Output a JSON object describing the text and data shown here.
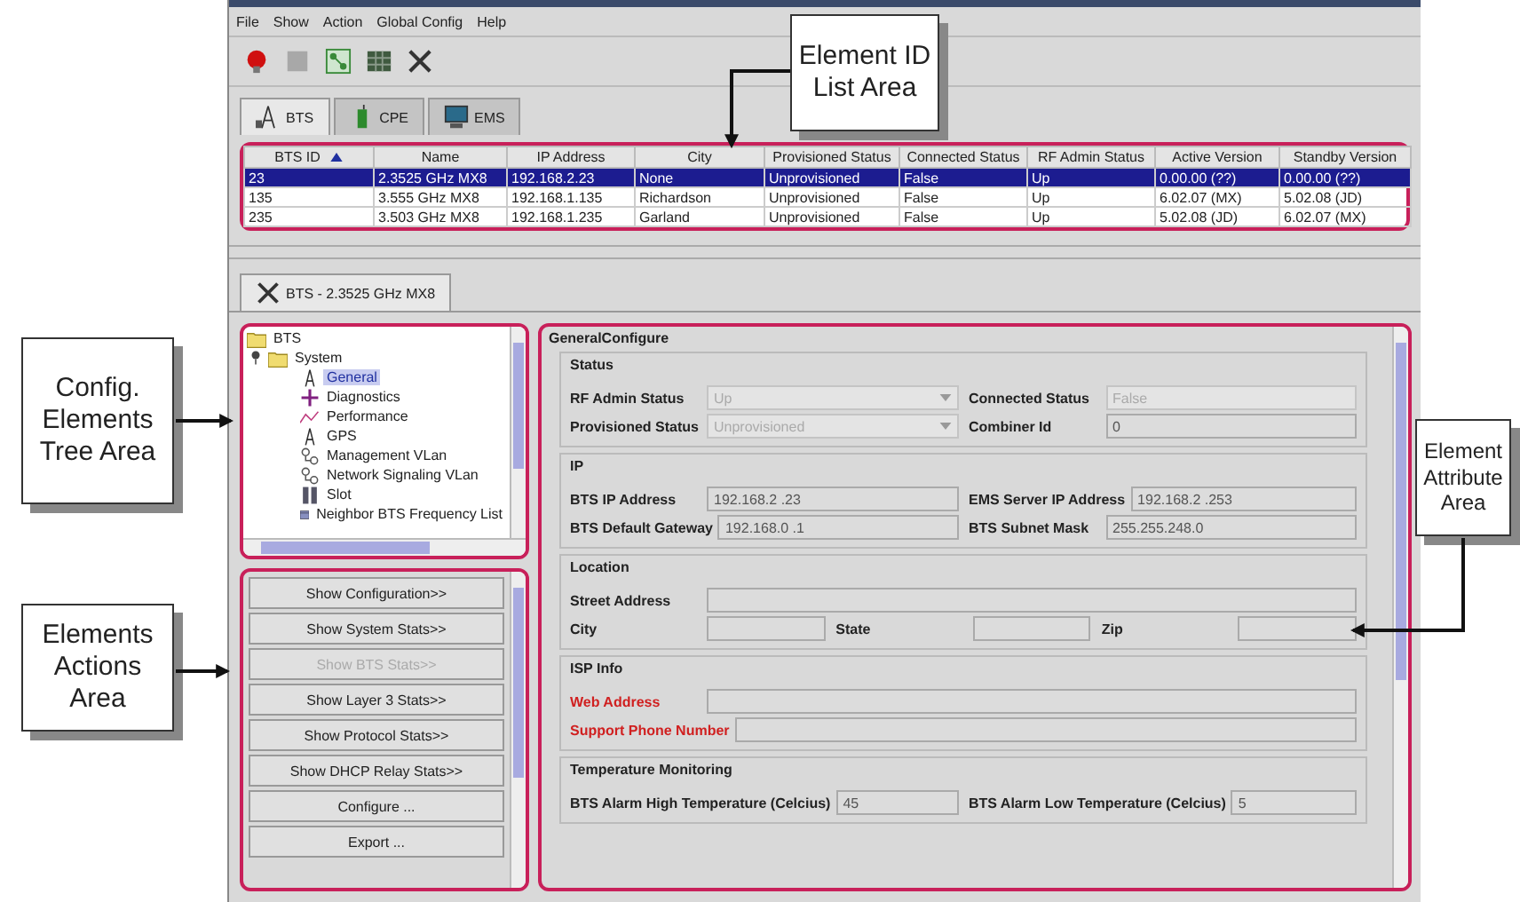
{
  "menu": [
    "File",
    "Show",
    "Action",
    "Global Config",
    "Help"
  ],
  "tabs": [
    {
      "label": "BTS",
      "kind": "tower",
      "selected": true
    },
    {
      "label": "CPE",
      "kind": "phone",
      "selected": false
    },
    {
      "label": "EMS",
      "kind": "monitor",
      "selected": false
    }
  ],
  "table": {
    "columns": [
      {
        "label": "BTS ID",
        "sorted": true
      },
      {
        "label": "Name",
        "sorted": false
      },
      {
        "label": "IP Address",
        "sorted": false
      },
      {
        "label": "City",
        "sorted": false
      },
      {
        "label": "Provisioned Status",
        "sorted": false
      },
      {
        "label": "Connected Status",
        "sorted": false
      },
      {
        "label": "RF Admin Status",
        "sorted": false
      },
      {
        "label": "Active Version",
        "sorted": false
      },
      {
        "label": "Standby Version",
        "sorted": false
      }
    ],
    "rows": [
      {
        "selected": true,
        "cells": [
          "23",
          "2.3525 GHz MX8",
          "192.168.2.23",
          "None",
          "Unprovisioned",
          "False",
          "Up",
          "0.00.00 (??)",
          "0.00.00 (??)"
        ]
      },
      {
        "selected": false,
        "cells": [
          "135",
          "3.555 GHz MX8",
          "192.168.1.135",
          "Richardson",
          "Unprovisioned",
          "False",
          "Up",
          "6.02.07 (MX)",
          "5.02.08 (JD)"
        ]
      },
      {
        "selected": false,
        "cells": [
          "235",
          "3.503 GHz MX8",
          "192.168.1.235",
          "Garland",
          "Unprovisioned",
          "False",
          "Up",
          "5.02.08 (JD)",
          "6.02.07 (MX)"
        ]
      }
    ]
  },
  "element_tab": "BTS - 2.3525 GHz MX8",
  "tree": [
    {
      "label": "BTS",
      "kind": "folder",
      "selected": false,
      "children": [
        {
          "label": "System",
          "kind": "folder",
          "selected": false,
          "expanded": true,
          "children": [
            {
              "label": "General",
              "kind": "tower",
              "selected": true
            },
            {
              "label": "Diagnostics",
              "kind": "diag",
              "selected": false
            },
            {
              "label": "Performance",
              "kind": "chart",
              "selected": false
            },
            {
              "label": "GPS",
              "kind": "tower",
              "selected": false
            },
            {
              "label": "Management VLan",
              "kind": "network",
              "selected": false
            },
            {
              "label": "Network Signaling VLan",
              "kind": "network",
              "selected": false
            },
            {
              "label": "Slot",
              "kind": "slot",
              "selected": false
            },
            {
              "label": "Neighbor BTS Frequency List",
              "kind": "list",
              "selected": false
            }
          ]
        }
      ]
    }
  ],
  "actions": [
    {
      "label": "Show Configuration>>",
      "disabled": false
    },
    {
      "label": "Show System Stats>>",
      "disabled": false
    },
    {
      "label": "Show BTS Stats>>",
      "disabled": true
    },
    {
      "label": "Show Layer 3 Stats>>",
      "disabled": false
    },
    {
      "label": "Show Protocol Stats>>",
      "disabled": false
    },
    {
      "label": "Show DHCP Relay Stats>>",
      "disabled": false
    },
    {
      "label": "Configure ...",
      "disabled": false
    },
    {
      "label": "Export ...",
      "disabled": false
    }
  ],
  "attributes": {
    "title": "GeneralConfigure",
    "sections": [
      {
        "title": "Status",
        "rows": [
          [
            {
              "label": "RF Admin Status",
              "value": "Up",
              "kind": "dropdown",
              "disabled": true,
              "required": false
            },
            {
              "label": "Connected Status",
              "value": "False",
              "kind": "text",
              "disabled": true,
              "required": false
            }
          ],
          [
            {
              "label": "Provisioned Status",
              "value": "Unprovisioned",
              "kind": "dropdown",
              "disabled": true,
              "required": false
            },
            {
              "label": "Combiner Id",
              "value": "0",
              "kind": "text",
              "disabled": false,
              "required": false
            }
          ]
        ]
      },
      {
        "title": "IP",
        "rows": [
          [
            {
              "label": "BTS IP Address",
              "value": "192.168.2 .23",
              "kind": "text",
              "disabled": false,
              "required": false
            },
            {
              "label": "EMS Server IP Address",
              "value": "192.168.2 .253",
              "kind": "text",
              "disabled": false,
              "required": false
            }
          ],
          [
            {
              "label": "BTS Default Gateway",
              "value": "192.168.0 .1",
              "kind": "text",
              "disabled": false,
              "required": false
            },
            {
              "label": "BTS Subnet Mask",
              "value": "255.255.248.0",
              "kind": "text",
              "disabled": false,
              "required": false
            }
          ]
        ]
      },
      {
        "title": "Location",
        "rows": [
          [
            {
              "label": "Street Address",
              "kind": "text",
              "disabled": false,
              "required": false
            }
          ],
          [
            {
              "label": "City",
              "kind": "text",
              "disabled": false,
              "required": false
            },
            {
              "label": "State",
              "kind": "text",
              "disabled": false,
              "required": false
            },
            {
              "label": "Zip",
              "kind": "text",
              "disabled": false,
              "required": false
            }
          ]
        ]
      },
      {
        "title": "ISP Info",
        "rows": [
          [
            {
              "label": "Web Address",
              "kind": "text",
              "disabled": false,
              "required": true
            }
          ],
          [
            {
              "label": "Support Phone Number",
              "kind": "text",
              "disabled": false,
              "required": true
            }
          ]
        ]
      },
      {
        "title": "Temperature Monitoring",
        "rows": [
          [
            {
              "label": "BTS Alarm High Temperature (Celcius)",
              "value": "45",
              "kind": "text",
              "disabled": false,
              "required": false
            },
            {
              "label": "BTS Alarm Low Temperature (Celcius)",
              "value": "5",
              "kind": "text",
              "disabled": false,
              "required": false
            }
          ]
        ]
      }
    ]
  },
  "callouts": [
    {
      "text": "Element ID List Area",
      "kind": "top"
    },
    {
      "text": "Config. Elements Tree Area",
      "kind": "tree"
    },
    {
      "text": "Elements Actions Area",
      "kind": "actions"
    },
    {
      "text": "Element Attribute Area",
      "kind": "attributes"
    }
  ]
}
